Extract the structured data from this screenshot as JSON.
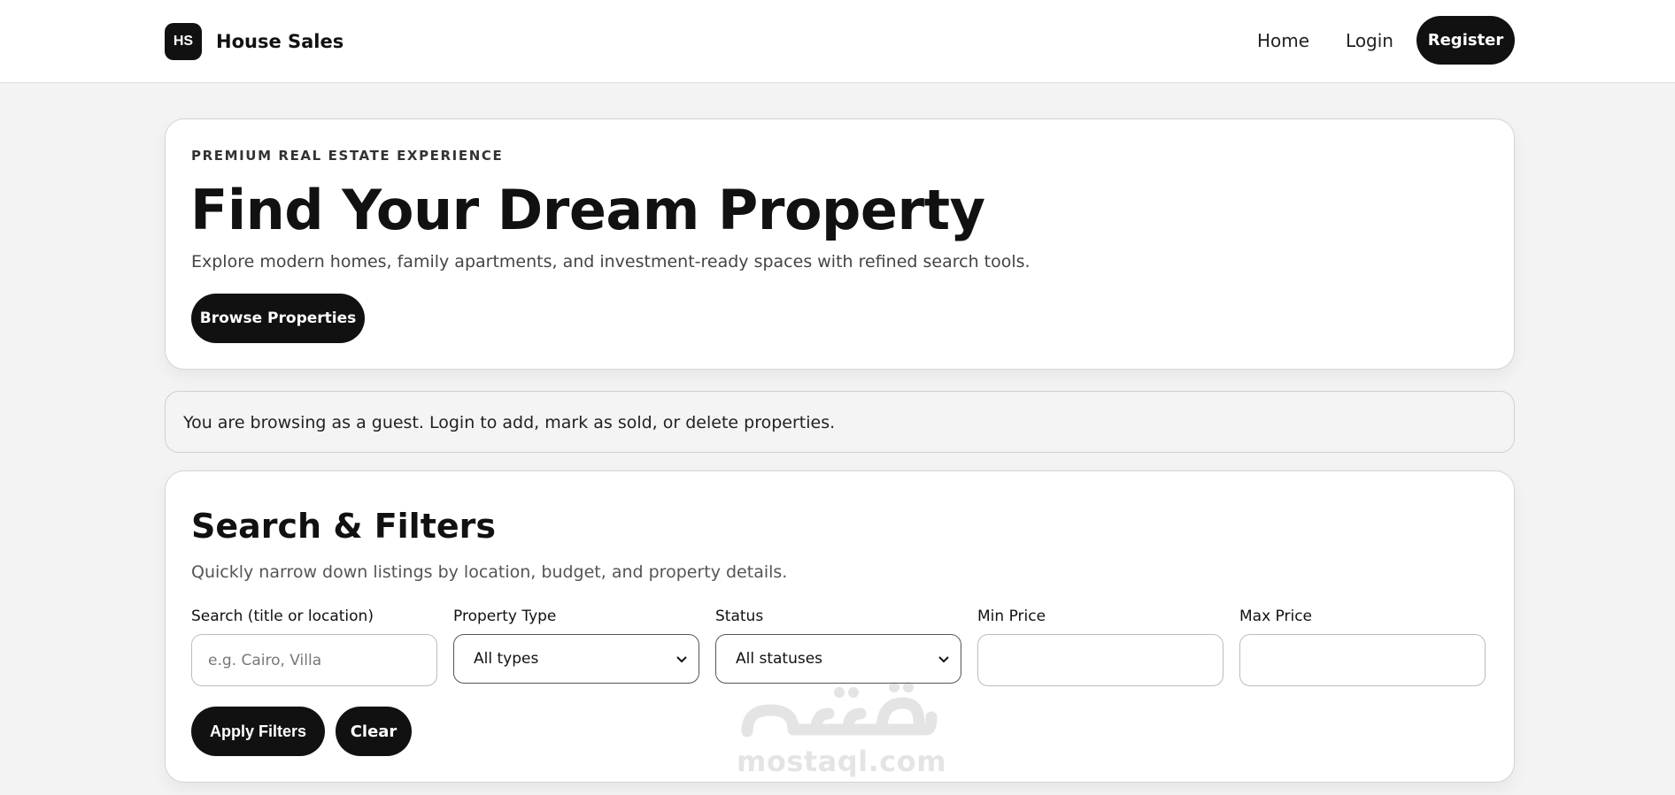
{
  "header": {
    "logo_initials": "HS",
    "brand_name": "House Sales",
    "nav": {
      "home": "Home",
      "login": "Login",
      "register": "Register"
    }
  },
  "hero": {
    "eyebrow": "PREMIUM REAL ESTATE EXPERIENCE",
    "title": "Find Your Dream Property",
    "subtitle": "Explore modern homes, family apartments, and investment-ready spaces with refined search tools.",
    "cta": "Browse Properties"
  },
  "notice": {
    "text": "You are browsing as a guest. Login to add, mark as sold, or delete properties."
  },
  "filters": {
    "title": "Search & Filters",
    "subtitle": "Quickly narrow down listings by location, budget, and property details.",
    "search": {
      "label": "Search (title or location)",
      "placeholder": "e.g. Cairo, Villa",
      "value": ""
    },
    "property_type": {
      "label": "Property Type",
      "selected": "All types"
    },
    "status": {
      "label": "Status",
      "selected": "All statuses"
    },
    "min_price": {
      "label": "Min Price",
      "value": ""
    },
    "max_price": {
      "label": "Max Price",
      "value": ""
    },
    "apply": "Apply Filters",
    "clear": "Clear"
  },
  "watermark": {
    "arabic": "مستقل",
    "latin": "mostaql.com"
  },
  "icons": {
    "select_arrow": "chevron-down-icon"
  },
  "colors": {
    "primary": "#111111",
    "page_background": "#f3f3f3",
    "card_background": "#ffffff"
  }
}
